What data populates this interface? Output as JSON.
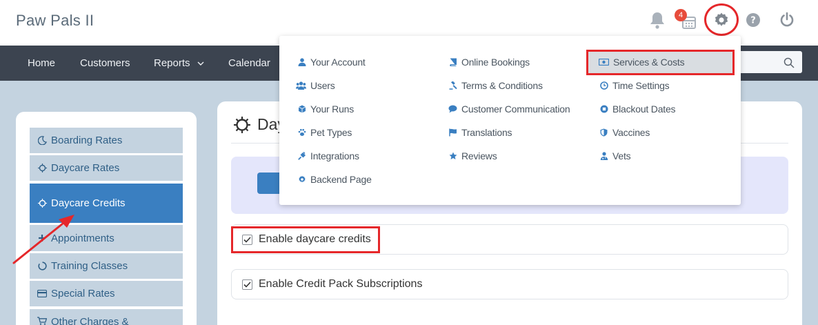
{
  "app": {
    "title": "Paw Pals II"
  },
  "header": {
    "calendar_badge": "4",
    "icons": [
      "bell-icon",
      "calendar-icon",
      "gear-icon",
      "help-icon",
      "power-icon"
    ]
  },
  "nav": {
    "home": "Home",
    "customers": "Customers",
    "reports": "Reports",
    "calendar": "Calendar"
  },
  "sidebar": {
    "items": [
      {
        "label": "Boarding Rates",
        "icon": "moon-icon"
      },
      {
        "label": "Daycare Rates",
        "icon": "sun-icon"
      },
      {
        "label": "Daycare Credits",
        "icon": "sun-icon",
        "active": true
      },
      {
        "label": "Appointments",
        "icon": "plus-icon"
      },
      {
        "label": "Training Classes",
        "icon": "circle-notch-icon"
      },
      {
        "label": "Special Rates",
        "icon": "card-icon"
      },
      {
        "label": "Other Charges &",
        "icon": "cart-icon"
      }
    ]
  },
  "main": {
    "title": "Day",
    "options": [
      {
        "label": "Enable daycare credits",
        "checked": true
      },
      {
        "label": "Enable Credit Pack Subscriptions",
        "checked": true
      }
    ]
  },
  "settings_menu": {
    "col1": [
      "Your Account",
      "Users",
      "Your Runs",
      "Pet Types",
      "Integrations",
      "Backend Page"
    ],
    "col2": [
      "Online Bookings",
      "Terms & Conditions",
      "Customer Communication",
      "Translations",
      "Reviews"
    ],
    "col3": [
      "Services & Costs",
      "Time Settings",
      "Blackout Dates",
      "Vaccines",
      "Vets"
    ]
  },
  "colors": {
    "accent": "#3a7fc1",
    "navbar": "#3c4450",
    "highlight": "#e5272a",
    "badge": "#e74c3c"
  }
}
